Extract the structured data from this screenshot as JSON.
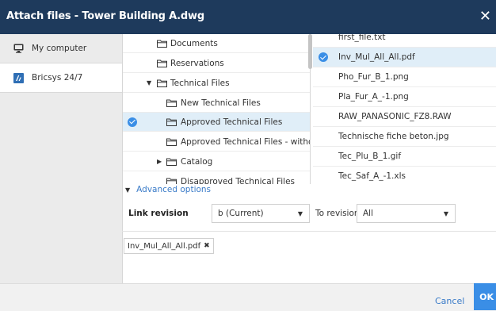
{
  "dialog": {
    "title": "Attach files - Tower Building A.dwg",
    "close_label": "✕"
  },
  "sources": [
    {
      "label": "My computer",
      "icon": "monitor-icon",
      "active": false
    },
    {
      "label": "Bricsys 24/7",
      "icon": "bricsys-logo-icon",
      "active": true
    }
  ],
  "tree": [
    {
      "label": "Documents",
      "indent": 1,
      "caret": "",
      "selected": false
    },
    {
      "label": "Reservations",
      "indent": 1,
      "caret": "",
      "selected": false
    },
    {
      "label": "Technical Files",
      "indent": 1,
      "caret": "down",
      "selected": false
    },
    {
      "label": "New Technical Files",
      "indent": 2,
      "caret": "",
      "selected": false
    },
    {
      "label": "Approved Technical Files",
      "indent": 2,
      "caret": "",
      "selected": true
    },
    {
      "label": "Approved Technical Files - without n...",
      "indent": 2,
      "caret": "",
      "selected": false
    },
    {
      "label": "Catalog",
      "indent": 1,
      "caret": "right",
      "selected": false
    },
    {
      "label": "Disapproved Technical Files",
      "indent": 2,
      "caret": "",
      "selected": false
    }
  ],
  "files": [
    {
      "name": "first_file.txt",
      "selected": false
    },
    {
      "name": "Inv_Mul_All_All.pdf",
      "selected": true
    },
    {
      "name": "Pho_Fur_B_1.png",
      "selected": false
    },
    {
      "name": "Pla_Fur_A_-1.png",
      "selected": false
    },
    {
      "name": "RAW_PANASONIC_FZ8.RAW",
      "selected": false
    },
    {
      "name": "Technische fiche beton.jpg",
      "selected": false
    },
    {
      "name": "Tec_Plu_B_1.gif",
      "selected": false
    },
    {
      "name": "Tec_Saf_A_-1.xls",
      "selected": false
    }
  ],
  "advanced": {
    "toggle_label": "Advanced options",
    "expanded": true
  },
  "revision": {
    "link_label": "Link revision",
    "link_value": "b (Current)",
    "to_label": "To revision",
    "to_value": "All"
  },
  "attached": [
    {
      "name": "Inv_Mul_All_All.pdf",
      "remove": "✖"
    }
  ],
  "footer": {
    "cancel_label": "Cancel",
    "ok_label": "OK"
  },
  "colors": {
    "titlebar": "#1e3a5c",
    "accent": "#3a8ee6",
    "selection": "#e0eef8",
    "link": "#3a7bc8"
  }
}
